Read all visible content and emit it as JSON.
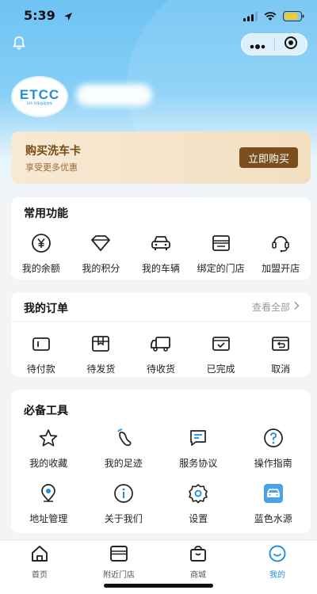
{
  "status_bar": {
    "time": "5:39"
  },
  "header": {
    "logo_text": "ETCC",
    "logo_subtext": "24h 共享自助洗车"
  },
  "banner": {
    "title": "购买洗车卡",
    "subtitle": "享受更多优惠",
    "button_label": "立即购买"
  },
  "common_functions": {
    "title": "常用功能",
    "items": [
      {
        "label": "我的余额",
        "icon": "yen-icon"
      },
      {
        "label": "我的积分",
        "icon": "diamond-icon"
      },
      {
        "label": "我的车辆",
        "icon": "car-icon"
      },
      {
        "label": "绑定的门店",
        "icon": "store-icon"
      },
      {
        "label": "加盟开店",
        "icon": "headset-icon"
      }
    ]
  },
  "orders": {
    "title": "我的订单",
    "view_all": "查看全部",
    "items": [
      {
        "label": "待付款",
        "icon": "wallet-icon"
      },
      {
        "label": "待发货",
        "icon": "package-icon"
      },
      {
        "label": "待收货",
        "icon": "truck-icon"
      },
      {
        "label": "已完成",
        "icon": "check-box-icon"
      },
      {
        "label": "取消",
        "icon": "return-icon"
      }
    ]
  },
  "tools": {
    "title": "必备工具",
    "items": [
      {
        "label": "我的收藏",
        "icon": "star-icon"
      },
      {
        "label": "我的足迹",
        "icon": "footprint-icon"
      },
      {
        "label": "服务协议",
        "icon": "agreement-icon"
      },
      {
        "label": "操作指南",
        "icon": "help-icon"
      },
      {
        "label": "地址管理",
        "icon": "location-icon"
      },
      {
        "label": "关于我们",
        "icon": "info-icon"
      },
      {
        "label": "设置",
        "icon": "settings-icon"
      },
      {
        "label": "蓝色水源",
        "icon": "blue-car-icon"
      }
    ]
  },
  "tabbar": {
    "tabs": [
      {
        "label": "首页",
        "icon": "home-icon"
      },
      {
        "label": "附近门店",
        "icon": "nearby-store-icon"
      },
      {
        "label": "商城",
        "icon": "shopping-bag-icon"
      },
      {
        "label": "我的",
        "icon": "profile-icon",
        "active": true
      }
    ]
  },
  "colors": {
    "accent": "#1a8fe0",
    "banner_button": "#7b4e1f",
    "header_top": "#6ec3f3"
  }
}
